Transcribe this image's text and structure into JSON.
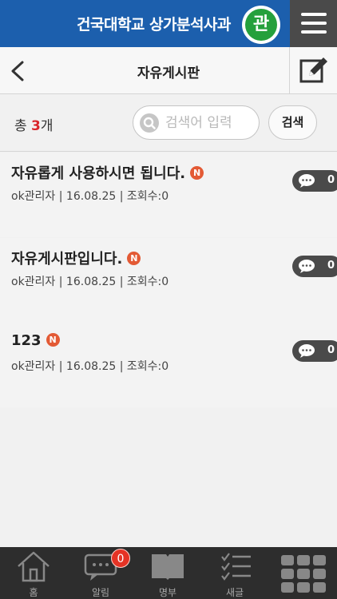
{
  "app": {
    "title": "건국대학교 상가분석사과",
    "badge": "관"
  },
  "header": {
    "title": "자유게시판"
  },
  "search": {
    "total_prefix": "총 ",
    "total_count": "3",
    "total_suffix": "개",
    "placeholder": "검색어 입력",
    "button": "검색"
  },
  "posts": [
    {
      "title": "자유롭게 사용하시면 됩니다.",
      "new_badge": "N",
      "meta": "ok관리자 | 16.08.25 | 조회수:0",
      "comments": "0"
    },
    {
      "title": "자유게시판입니다.",
      "new_badge": "N",
      "meta": "ok관리자 | 16.08.25 | 조회수:0",
      "comments": "0"
    },
    {
      "title": "123",
      "new_badge": "N",
      "meta": "ok관리자 | 16.08.25 | 조회수:0",
      "comments": "0"
    }
  ],
  "nav": {
    "items": [
      {
        "label": "홈",
        "icon": "home-icon"
      },
      {
        "label": "알림",
        "icon": "chat-icon",
        "badge": "0"
      },
      {
        "label": "명부",
        "icon": "book-icon"
      },
      {
        "label": "새글",
        "icon": "checklist-icon"
      },
      {
        "label": "",
        "icon": "grid-icon"
      }
    ]
  }
}
